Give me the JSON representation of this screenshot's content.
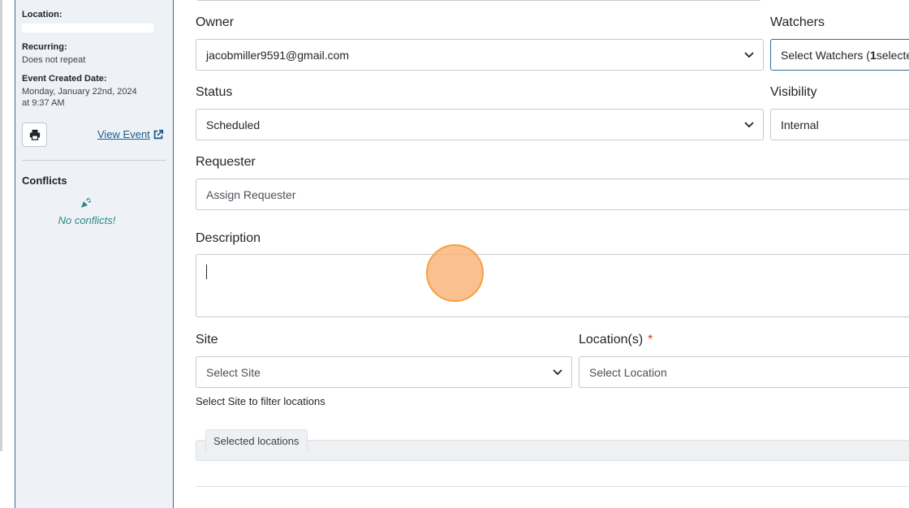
{
  "sidebar": {
    "location_label": "Location:",
    "recurring_label": "Recurring:",
    "recurring_value": "Does not repeat",
    "created_label": "Event Created Date:",
    "created_line1": "Monday, January 22nd, 2024",
    "created_line2": "at 9:37 AM",
    "print_icon": "printer-icon",
    "view_event_label": "View Event",
    "external_icon": "external-link-icon",
    "conflicts_title": "Conflicts",
    "party_icon": "party-popper-icon",
    "no_conflicts": "No conflicts!"
  },
  "form": {
    "owner_label": "Owner",
    "owner_value": "jacobmiller9591@gmail.com",
    "watchers_label": "Watchers",
    "watchers_prefix": "Select Watchers (",
    "watchers_count": "1",
    "watchers_suffix": " selecte",
    "status_label": "Status",
    "status_value": "Scheduled",
    "visibility_label": "Visibility",
    "visibility_value": "Internal",
    "requester_label": "Requester",
    "requester_value": "Assign Requester",
    "description_label": "Description",
    "description_value": "",
    "site_label": "Site",
    "site_value": "Select Site",
    "location_label": "Location(s)",
    "required_mark": "*",
    "location_value": "Select Location",
    "site_help": "Select Site to filter locations",
    "selected_locations_label": "Selected locations"
  },
  "colors": {
    "accent": "#2c6f95",
    "link": "#1a5d8c",
    "success_text": "#2a8a8a",
    "required": "#d23c2c",
    "cursor_fill": "#f9b276"
  }
}
